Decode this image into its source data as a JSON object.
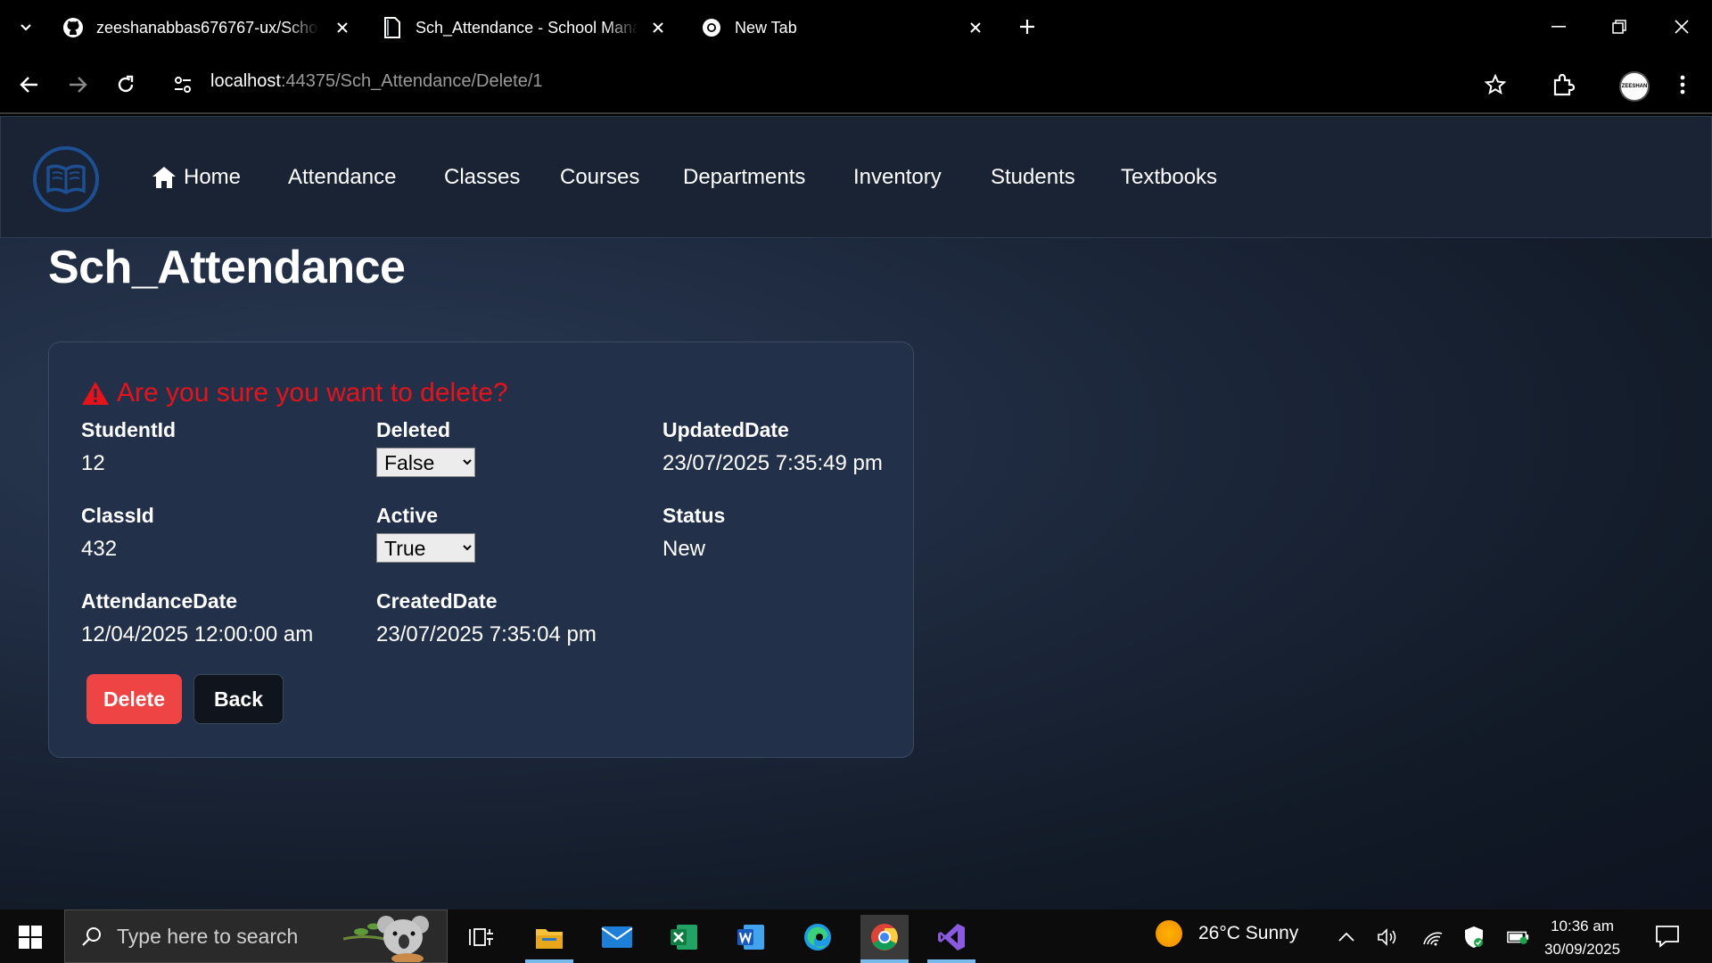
{
  "browser": {
    "tabs": [
      {
        "title": "zeeshanabbas676767-ux/Schoo",
        "icon": "github-icon"
      },
      {
        "title": "Sch_Attendance - School Mana",
        "icon": "page-icon"
      },
      {
        "title": "New Tab",
        "icon": "chrome-icon"
      }
    ],
    "url_host": "localhost",
    "url_path": ":44375/Sch_Attendance/Delete/1",
    "profile_label": "ZEESHAN"
  },
  "nav": {
    "items": [
      "Home",
      "Attendance",
      "Classes",
      "Courses",
      "Departments",
      "Inventory",
      "Students",
      "Textbooks"
    ]
  },
  "page": {
    "title": "Sch_Attendance",
    "warning": "Are you sure you want to delete?",
    "fields": {
      "student_id": {
        "label": "StudentId",
        "value": "12"
      },
      "class_id": {
        "label": "ClassId",
        "value": "432"
      },
      "attendance_date": {
        "label": "AttendanceDate",
        "value": "12/04/2025 12:00:00 am"
      },
      "deleted": {
        "label": "Deleted",
        "value": "False"
      },
      "active": {
        "label": "Active",
        "value": "True"
      },
      "created_date": {
        "label": "CreatedDate",
        "value": "23/07/2025 7:35:04 pm"
      },
      "updated_date": {
        "label": "UpdatedDate",
        "value": "23/07/2025 7:35:49 pm"
      },
      "status": {
        "label": "Status",
        "value": "New"
      }
    },
    "buttons": {
      "delete": "Delete",
      "back": "Back"
    }
  },
  "taskbar": {
    "search_placeholder": "Type here to search",
    "weather": "26°C  Sunny",
    "time": "10:36 am",
    "date": "30/09/2025"
  },
  "colors": {
    "danger": "#ef4444",
    "warning_text": "#e6131a",
    "navbar": "#192334",
    "card": "#223149"
  }
}
